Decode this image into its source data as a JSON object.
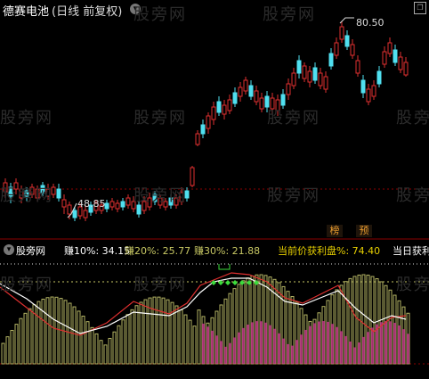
{
  "main": {
    "title": "德赛电池",
    "period": "(日线 前复权)",
    "high_label": "80.50",
    "low_label": "48.85",
    "corner_icon": "window-restore-icon",
    "badges": [
      "榜",
      "预"
    ]
  },
  "indicator": {
    "name": "股旁网",
    "legend": [
      {
        "label": "赚10%: 34.15",
        "color": "#ffffff"
      },
      {
        "label": "赚20%: 25.77",
        "color": "#c8c864"
      },
      {
        "label": "赚30%: 21.88",
        "color": "#c8c864"
      },
      {
        "label": "当前价获利盘%: 74.40",
        "color": "#e8d000"
      },
      {
        "label": "当日获利",
        "color": "#ffffff"
      }
    ]
  },
  "watermark": "股旁网",
  "colors": {
    "up": "#e03030",
    "down": "#50e0f0",
    "white": "#ffffff",
    "olive": "#b4b464",
    "magenta": "#c83c8c",
    "green": "#3cdc3c"
  }
}
